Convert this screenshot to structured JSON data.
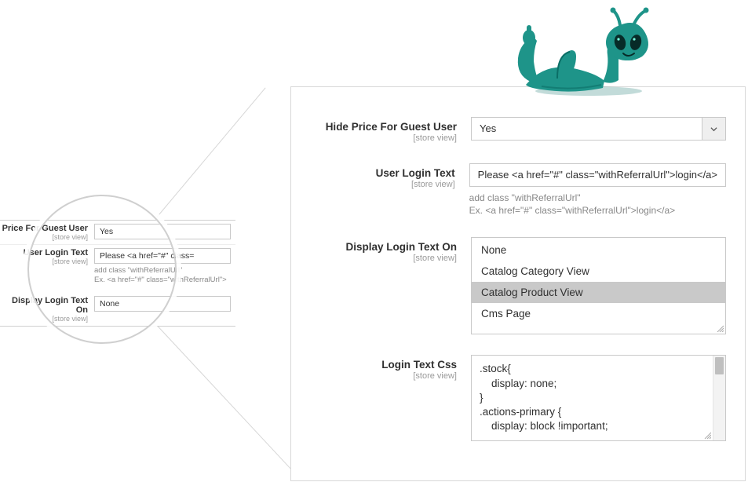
{
  "scope_text": "[store view]",
  "fields": {
    "hide_price": {
      "label": "Hide Price For Guest User",
      "value": "Yes"
    },
    "user_login_text": {
      "label": "User Login Text",
      "value": "Please <a href=\"#\" class=\"withReferralUrl\">login</a>",
      "hint_line1": "add class \"withReferralUrl\"",
      "hint_line2": "Ex. <a href=\"#\" class=\"withReferralUrl\">login</a>"
    },
    "display_on": {
      "label": "Display Login Text On",
      "options": {
        "none": "None",
        "catalog_category": "Catalog Category View",
        "catalog_product": "Catalog Product View",
        "cms_page": "Cms Page"
      },
      "selected": "catalog_product"
    },
    "login_css": {
      "label": "Login Text Css",
      "value": ".stock{\n    display: none;\n}\n.actions-primary {\n    display: block !important;"
    }
  },
  "preview": {
    "hide_price_label": "Price For Guest User",
    "hide_price_value": "Yes",
    "user_login_label": "User Login Text",
    "user_login_value": "Please <a href=\"#\" class=",
    "hint_line1": "add class \"withReferralUrl\"",
    "hint_line2": "Ex. <a href=\"#\" class=\"withReferralUrl\">",
    "display_on_label": "Display Login Text On",
    "option_none": "None"
  },
  "mascot_name": "alien-mascot"
}
